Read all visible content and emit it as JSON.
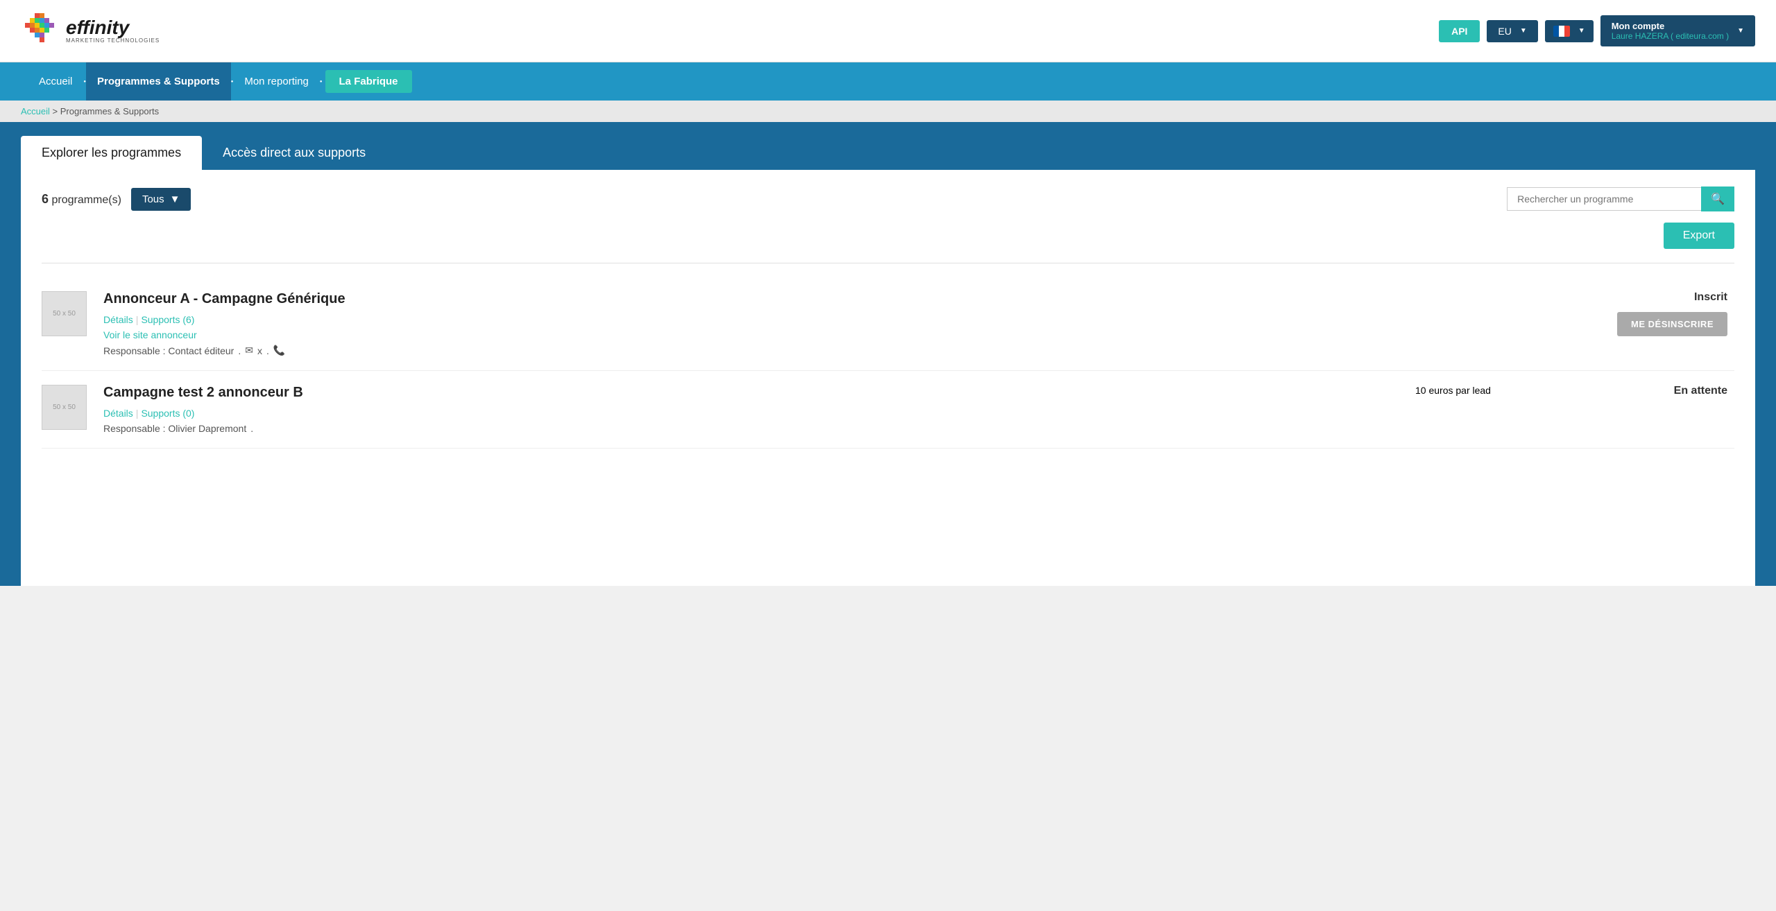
{
  "header": {
    "logo_name": "effinity",
    "logo_sub": "MARKETING\nTECHNOLOGIES",
    "api_label": "API",
    "region_label": "EU",
    "account_title": "Mon compte",
    "account_user": "Laure HAZERA ( editeura.com )"
  },
  "nav": {
    "items": [
      {
        "id": "accueil",
        "label": "Accueil",
        "active": false
      },
      {
        "id": "programmes",
        "label": "Programmes & Supports",
        "active": true
      },
      {
        "id": "reporting",
        "label": "Mon reporting",
        "active": false
      },
      {
        "id": "fabrique",
        "label": "La Fabrique",
        "active": false,
        "highlight": true
      }
    ]
  },
  "breadcrumb": {
    "home": "Accueil",
    "separator": ">",
    "current": "Programmes & Supports"
  },
  "tabs": [
    {
      "id": "explorer",
      "label": "Explorer les programmes",
      "active": true
    },
    {
      "id": "acces",
      "label": "Accès direct aux supports",
      "active": false
    }
  ],
  "programs": {
    "count": 6,
    "count_label": "programme(s)",
    "filter_label": "Tous",
    "search_placeholder": "Rechercher un programme",
    "export_label": "Export",
    "items": [
      {
        "id": "prog1",
        "title": "Annonceur A - Campagne Générique",
        "thumb_label": "50 x 50",
        "link_details": "Détails",
        "link_supports": "Supports (6)",
        "link_site": "Voir le site annonceur",
        "contact_label": "Responsable : Contact éditeur",
        "status": "Inscrit",
        "action_label": "ME DÉSINSCRIRE"
      },
      {
        "id": "prog2",
        "title": "Campagne test 2 annonceur B",
        "thumb_label": "50 x 50",
        "link_details": "Détails",
        "link_supports": "Supports (0)",
        "contact_label": "Responsable : Olivier Dapremont",
        "commission": "10 euros par lead",
        "status": "En attente",
        "action_label": ""
      }
    ]
  }
}
